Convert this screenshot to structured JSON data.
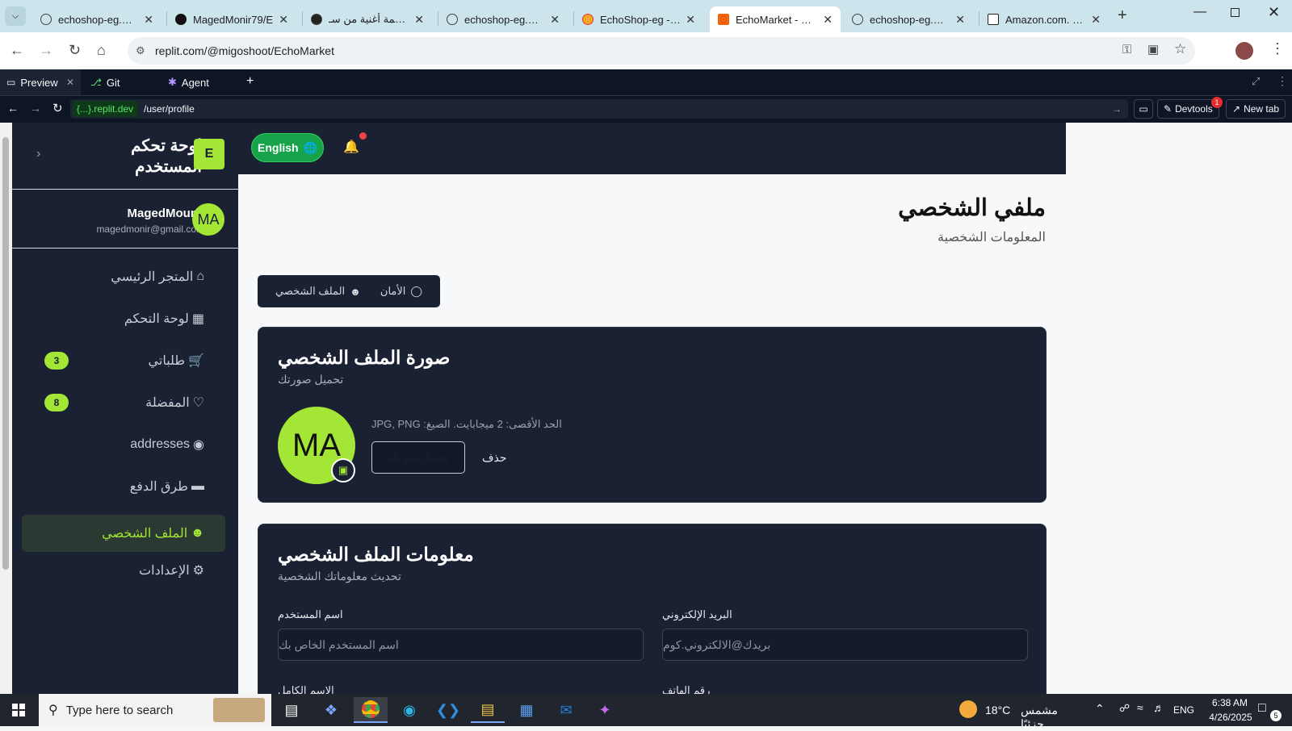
{
  "browser": {
    "tabs": [
      {
        "title": "echoshop-eg.web"
      },
      {
        "title": "MagedMonir79/E"
      },
      {
        "title": "ترجمة أغنية من سـ"
      },
      {
        "title": "echoshop-eg.web"
      },
      {
        "title": "EchoShop-eg - Au"
      },
      {
        "title": "EchoMarket - Rep"
      },
      {
        "title": "echoshop-eg.web"
      },
      {
        "title": "Amazon.com. Spe"
      }
    ],
    "url": "replit.com/@migoshoot/EchoMarket"
  },
  "replit": {
    "tabs": [
      {
        "label": "Preview"
      },
      {
        "label": "Git"
      },
      {
        "label": "Agent"
      }
    ],
    "domain": "{...}.replit.dev",
    "path": "/user/profile",
    "devtools_label": "Devtools",
    "devtools_count": "1",
    "newtab_label": "New tab"
  },
  "sidebar": {
    "logo_letter": "E",
    "title": "لوحة تحكم المستخدم",
    "user": {
      "initials": "MA",
      "name": "MagedMounir",
      "email": "magedmonir@gmail.com"
    },
    "items": [
      {
        "label": "المتجر الرئيسي",
        "icon": "home-icon"
      },
      {
        "label": "لوحة التحكم",
        "icon": "dashboard-icon"
      },
      {
        "label": "طلباتي",
        "icon": "cart-icon",
        "badge": "3"
      },
      {
        "label": "المفضلة",
        "icon": "heart-icon",
        "badge": "8"
      },
      {
        "label": "addresses",
        "icon": "map-pin-icon"
      },
      {
        "label": "طرق الدفع",
        "icon": "credit-card-icon"
      },
      {
        "label": "الملف الشخصي",
        "icon": "user-icon",
        "active": true
      },
      {
        "label": "الإعدادات",
        "icon": "settings-icon"
      }
    ]
  },
  "topbar": {
    "language_button": "English"
  },
  "page": {
    "title": "ملفي الشخصي",
    "subtitle": "المعلومات الشخصية",
    "tabs": [
      {
        "label": "الملف الشخصي"
      },
      {
        "label": "الأمان"
      }
    ]
  },
  "photo_card": {
    "title": "صورة الملف الشخصي",
    "subtitle": "تحميل صورتك",
    "initials": "MA",
    "hint": "JPG, PNG :الحد الأقصى: 2 ميجابايت. الصيغ",
    "upload_label": "تحميل صورتك",
    "delete_label": "حذف"
  },
  "info_card": {
    "title": "معلومات الملف الشخصي",
    "subtitle": "تحديث معلوماتك الشخصية",
    "fields": [
      {
        "label": "البريد الإلكتروني",
        "placeholder": "بريدك@الالكتروني.كوم"
      },
      {
        "label": "اسم المستخدم",
        "placeholder": "اسم المستخدم الخاص بك"
      },
      {
        "label": "رقم الهاتف"
      },
      {
        "label": "الاسم الكامل"
      }
    ]
  },
  "taskbar": {
    "search_placeholder": "Type here to search",
    "weather_temp": "18°C",
    "weather_text": "مشمس جزئيًا",
    "lang": "ENG",
    "time": "6:38 AM",
    "date": "4/26/2025",
    "notifications": "5"
  },
  "colors": {
    "accent": "#a3e635",
    "dark_panel": "#1a2133",
    "notification_dot": "#ef4444"
  }
}
